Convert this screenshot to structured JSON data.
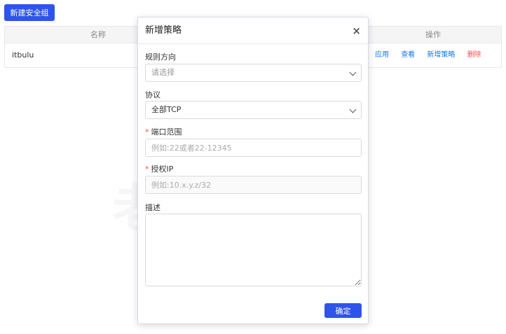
{
  "toolbar": {
    "new_security_group": "新建安全组"
  },
  "table": {
    "columns": {
      "name": "名称",
      "operations": "操作"
    },
    "rows": [
      {
        "name": "itbulu",
        "actions": {
          "apply": "应用",
          "view": "查看",
          "add_policy": "新增策略",
          "delete": "删除"
        }
      }
    ]
  },
  "watermark": "老蒋部落",
  "modal": {
    "title": "新增策略",
    "close": "×",
    "direction": {
      "label": "规则方向",
      "value": "请选择"
    },
    "protocol": {
      "label": "协议",
      "value": "全部TCP"
    },
    "port_range": {
      "required": "*",
      "label": "端口范围",
      "placeholder": "例如:22或者22-12345"
    },
    "auth_ip": {
      "required": "*",
      "label": "授权IP",
      "placeholder": "例如:10.x.y.z/32"
    },
    "description": {
      "label": "描述"
    },
    "confirm": "确定"
  },
  "colors": {
    "primary": "#2f54eb",
    "link": "#1677ff",
    "danger": "#ff4d4f",
    "required": "#ff4d4f"
  }
}
